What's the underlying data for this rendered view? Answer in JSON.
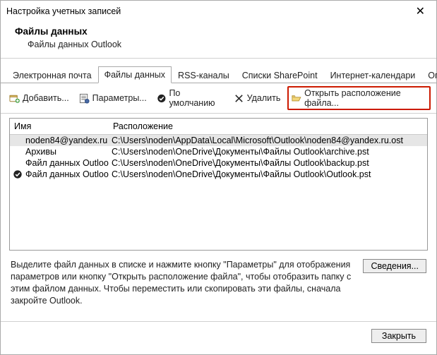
{
  "window_title": "Настройка учетных записей",
  "header": {
    "title": "Файлы данных",
    "subtitle": "Файлы данных Outlook"
  },
  "tabs": {
    "items": [
      "Электронная почта",
      "Файлы данных",
      "RSS-каналы",
      "Списки SharePoint",
      "Интернет-календари",
      "Опублико"
    ],
    "active_index": 1
  },
  "toolbar": {
    "add": "Добавить...",
    "settings": "Параметры...",
    "default": "По умолчанию",
    "remove": "Удалить",
    "open_location": "Открыть расположение файла..."
  },
  "list": {
    "columns": {
      "name": "Имя",
      "location": "Расположение"
    },
    "rows": [
      {
        "name": "noden84@yandex.ru",
        "location": "C:\\Users\\noden\\AppData\\Local\\Microsoft\\Outlook\\noden84@yandex.ru.ost",
        "default": false,
        "selected": true
      },
      {
        "name": "Архивы",
        "location": "C:\\Users\\noden\\OneDrive\\Документы\\Файлы Outlook\\archive.pst",
        "default": false,
        "selected": false
      },
      {
        "name": "Файл данных Outlook",
        "location": "C:\\Users\\noden\\OneDrive\\Документы\\Файлы Outlook\\backup.pst",
        "default": false,
        "selected": false
      },
      {
        "name": "Файл данных Outlook",
        "location": "C:\\Users\\noden\\OneDrive\\Документы\\Файлы Outlook\\Outlook.pst",
        "default": true,
        "selected": false
      }
    ]
  },
  "help_text": "Выделите файл данных в списке и нажмите кнопку \"Параметры\" для отображения параметров или кнопку \"Открыть расположение файла\", чтобы отобразить папку с этим файлом данных. Чтобы переместить или скопировать эти файлы, сначала закройте Outlook.",
  "buttons": {
    "details": "Сведения...",
    "close": "Закрыть"
  }
}
